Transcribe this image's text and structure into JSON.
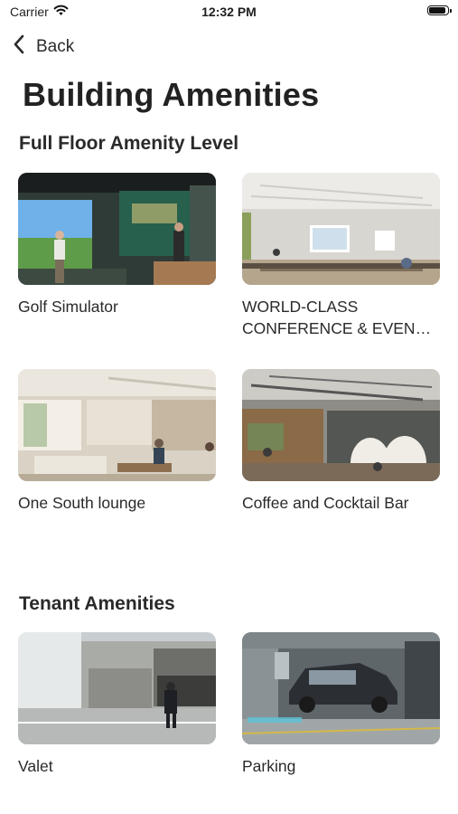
{
  "status_bar": {
    "carrier": "Carrier",
    "time": "12:32 PM",
    "battery_level": 0.95
  },
  "nav": {
    "back_label": "Back"
  },
  "page": {
    "title": "Building Amenities"
  },
  "sections": [
    {
      "title": "Full Floor Amenity Level",
      "items": [
        {
          "label": "Golf Simulator",
          "image": "golf-simulator-photo"
        },
        {
          "label": "WORLD-CLASS CONFERENCE & EVENT CENTER",
          "image": "conference-center-photo"
        },
        {
          "label": "One South lounge",
          "image": "lounge-photo"
        },
        {
          "label": "Coffee and Cocktail Bar",
          "image": "coffee-bar-photo"
        }
      ]
    },
    {
      "title": "Tenant Amenities",
      "items": [
        {
          "label": "Valet",
          "image": "valet-photo"
        },
        {
          "label": "Parking",
          "image": "parking-photo"
        }
      ]
    }
  ],
  "colors": {
    "background": "#ffffff",
    "text": "#222222",
    "accent": "#1f1f1f"
  }
}
